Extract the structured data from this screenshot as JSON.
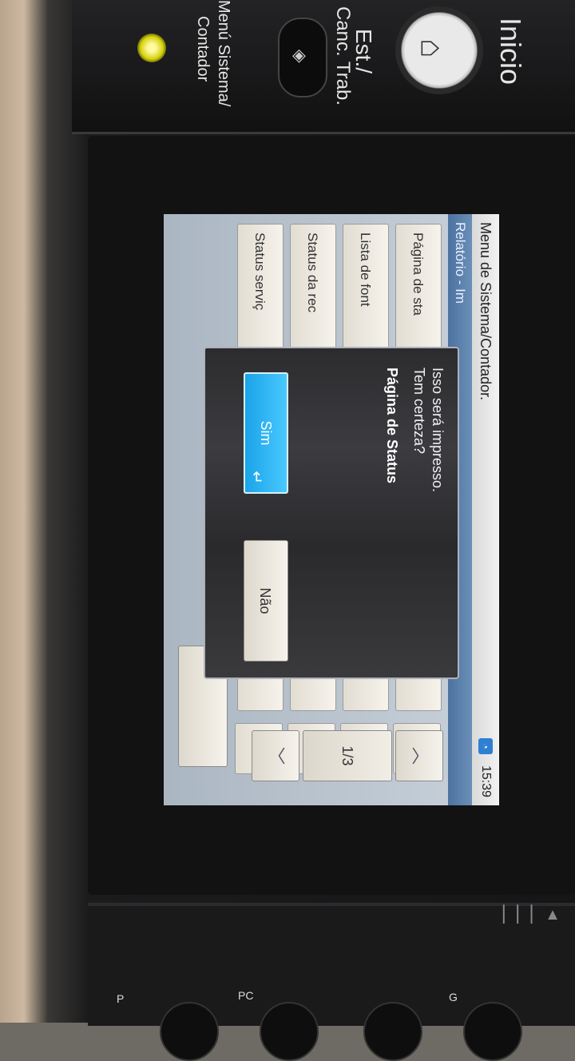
{
  "hardware": {
    "home_label": "Inicio",
    "status_label_line1": "Est./",
    "status_label_line2": "Canc. Trab.",
    "system_menu_label_line1": "Menú Sistema/",
    "system_menu_label_line2": "Contador",
    "bottom_label_1": "P",
    "bottom_label_2": "PC",
    "bottom_label_3": "G"
  },
  "screen": {
    "header_title": "Menu de Sistema/Contador.",
    "time": "15:39",
    "subheader": "Relatório - Im",
    "list_items": [
      "Página de sta",
      "Lista de font",
      "Status da rec",
      "Status serviç"
    ],
    "page_indicator": "1/3"
  },
  "dialog": {
    "message_line1": "Isso será impresso.",
    "message_line2": "Tem certeza?",
    "document_name": "Página de Status",
    "yes_label": "Sim",
    "no_label": "Não"
  }
}
